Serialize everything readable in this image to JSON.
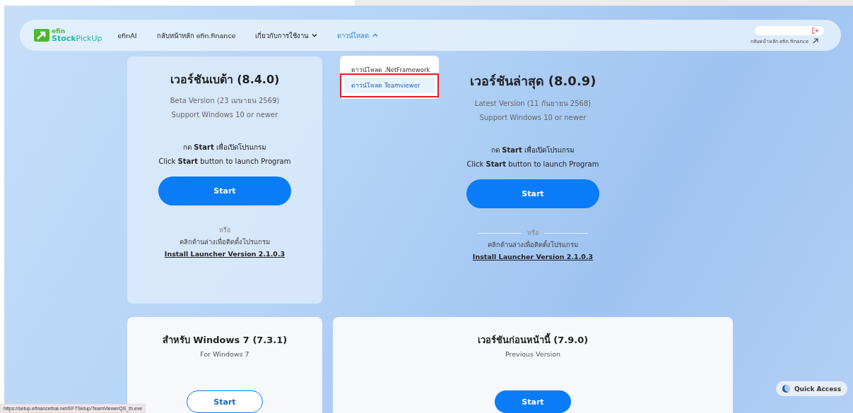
{
  "nav": {
    "logo": {
      "top": "efin",
      "bottom_main": "Stock",
      "bottom_accent": "PickUp"
    },
    "items": [
      {
        "kind": "link",
        "label": "efinAI",
        "selected": false
      },
      {
        "kind": "link",
        "label": "กลับหน้าหลัก efin.finance",
        "selected": false
      },
      {
        "kind": "menu",
        "label": "เกี่ยวกับการใช้งาน",
        "selected": false,
        "expanded": false
      },
      {
        "kind": "menu",
        "label": "ดาวน์โหลด",
        "selected": true,
        "expanded": true
      }
    ],
    "account": {
      "link": "กลับหน้าหลัก efin.finance"
    }
  },
  "dropdown": {
    "items": [
      {
        "label": "ดาวน์โหลด .NetFramework",
        "selected": false
      },
      {
        "label": "ดาวน์โหลด Teamviewer",
        "selected": true
      }
    ]
  },
  "versions": [
    {
      "kind": "beta",
      "title": "เวอร์ชันเบต้า (8.4.0)",
      "subtitle": "Beta Version (23 เมษายน 2569)",
      "support": "Support Windows 10 or newer",
      "hint_th": "กด **Start** เพื่อเปิดโปรแกรม",
      "hint_en": "Click **Start** button to launch Program",
      "button": "Start",
      "or": "หรือ",
      "install_hint": "คลิกด้านล่างเพื่อติดตั้งโปรแกรม",
      "install_link": "Install Launcher Version 2.1.0.3"
    },
    {
      "kind": "latest",
      "title": "เวอร์ชันล่าสุด (8.0.9)",
      "subtitle": "Latest Version (11 กันยายน 2568)",
      "support": "Support Windows 10 or newer",
      "hint_th": "กด **Start** เพื่อเปิดโปรแกรม",
      "hint_en": "Click **Start** button to launch Program",
      "button": "Start",
      "or": "หรือ",
      "install_hint": "คลิกด้านล่างเพื่อติดตั้งโปรแกรม",
      "install_link": "Install Launcher Version 2.1.0.3"
    },
    {
      "kind": "legacy",
      "title": "สำหรับ Windows 7 (7.3.1)",
      "subtitle": "For Windows 7",
      "button": "Start"
    },
    {
      "kind": "previous",
      "title": "เวอร์ชันก่อนหน้านี้ (7.9.0)",
      "subtitle": "Previous Version",
      "button": "Start"
    }
  ],
  "quick_access": {
    "label": "Quick Access"
  },
  "status_bar": {
    "url": "https://setup.efinancethai.net/EFTSetup/TeamViewerQS_th.exe"
  }
}
